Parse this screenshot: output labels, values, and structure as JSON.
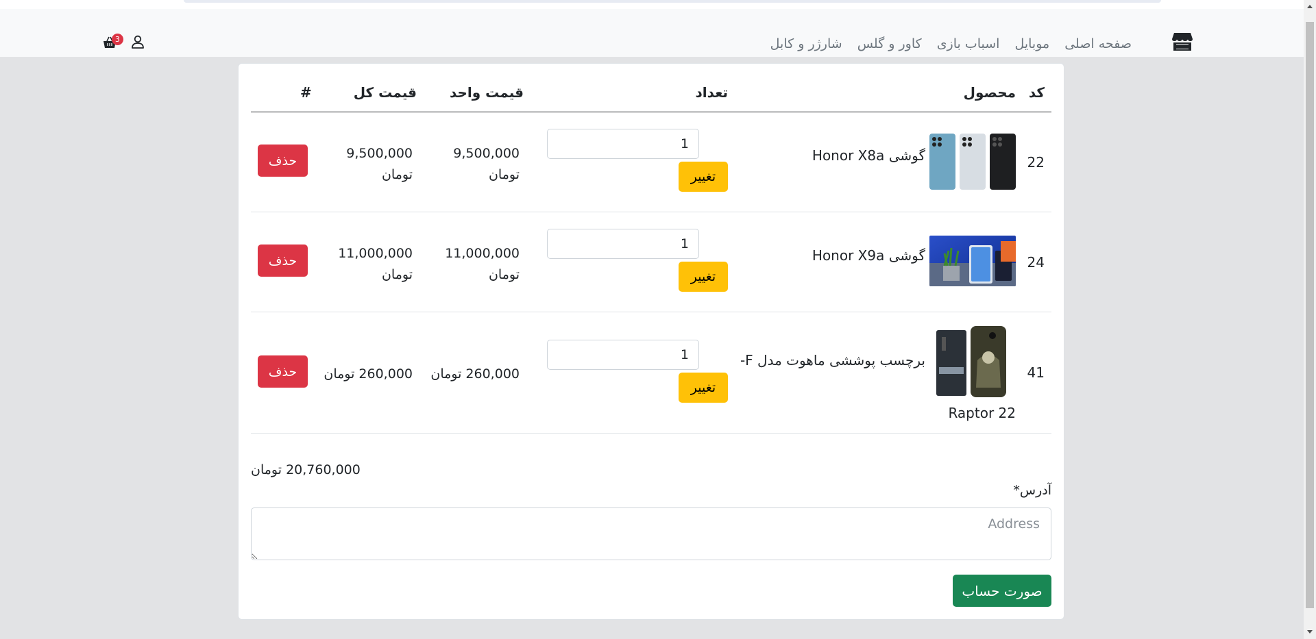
{
  "nav": {
    "links": [
      "صفحه اصلی",
      "موبایل",
      "اسباب بازی",
      "کاور و گلس",
      "شارژر و کابل"
    ],
    "cart_count": "3"
  },
  "table": {
    "headers": {
      "code": "کد",
      "product": "محصول",
      "quantity": "تعداد",
      "unit_price": "قیمت واحد",
      "total_price": "قیمت کل",
      "hash": "#"
    },
    "rows": [
      {
        "code": "22",
        "name": "گوشی Honor X8a",
        "qty": "1",
        "unit_price": "9,500,000 تومان",
        "total_price": "9,500,000 تومان",
        "change_label": "تغییر",
        "delete_label": "حذف"
      },
      {
        "code": "24",
        "name": "گوشی Honor  X9a",
        "qty": "1",
        "unit_price": "11,000,000 تومان",
        "total_price": "11,000,000 تومان",
        "change_label": "تغییر",
        "delete_label": "حذف"
      },
      {
        "code": "41",
        "name": "برچسب پوششی ماهوت مدل F-",
        "name_line2": "22 Raptor",
        "qty": "1",
        "unit_price": "260,000 تومان",
        "total_price": "260,000 تومان",
        "change_label": "تغییر",
        "delete_label": "حذف"
      }
    ]
  },
  "order": {
    "grand_total": "20,760,000 تومان",
    "address_label": "آدرس*",
    "address_placeholder": "Address",
    "invoice_button": "صورت حساب"
  },
  "colors": {
    "navbar_bg": "#f8f9fa",
    "page_bg": "#e2e3e5",
    "change_button": "#ffc107",
    "delete_button": "#dc3545",
    "invoice_button": "#198754",
    "badge": "#dc3545"
  },
  "icons": [
    "store-icon",
    "user-icon",
    "basket-icon"
  ]
}
